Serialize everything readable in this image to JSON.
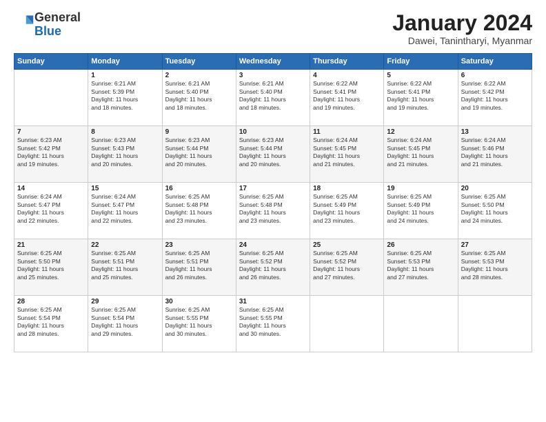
{
  "logo": {
    "general": "General",
    "blue": "Blue"
  },
  "title": "January 2024",
  "subtitle": "Dawei, Tanintharyi, Myanmar",
  "headers": [
    "Sunday",
    "Monday",
    "Tuesday",
    "Wednesday",
    "Thursday",
    "Friday",
    "Saturday"
  ],
  "rows": [
    [
      {
        "day": "",
        "info": ""
      },
      {
        "day": "1",
        "info": "Sunrise: 6:21 AM\nSunset: 5:39 PM\nDaylight: 11 hours\nand 18 minutes."
      },
      {
        "day": "2",
        "info": "Sunrise: 6:21 AM\nSunset: 5:40 PM\nDaylight: 11 hours\nand 18 minutes."
      },
      {
        "day": "3",
        "info": "Sunrise: 6:21 AM\nSunset: 5:40 PM\nDaylight: 11 hours\nand 18 minutes."
      },
      {
        "day": "4",
        "info": "Sunrise: 6:22 AM\nSunset: 5:41 PM\nDaylight: 11 hours\nand 19 minutes."
      },
      {
        "day": "5",
        "info": "Sunrise: 6:22 AM\nSunset: 5:41 PM\nDaylight: 11 hours\nand 19 minutes."
      },
      {
        "day": "6",
        "info": "Sunrise: 6:22 AM\nSunset: 5:42 PM\nDaylight: 11 hours\nand 19 minutes."
      }
    ],
    [
      {
        "day": "7",
        "info": "Sunrise: 6:23 AM\nSunset: 5:42 PM\nDaylight: 11 hours\nand 19 minutes."
      },
      {
        "day": "8",
        "info": "Sunrise: 6:23 AM\nSunset: 5:43 PM\nDaylight: 11 hours\nand 20 minutes."
      },
      {
        "day": "9",
        "info": "Sunrise: 6:23 AM\nSunset: 5:44 PM\nDaylight: 11 hours\nand 20 minutes."
      },
      {
        "day": "10",
        "info": "Sunrise: 6:23 AM\nSunset: 5:44 PM\nDaylight: 11 hours\nand 20 minutes."
      },
      {
        "day": "11",
        "info": "Sunrise: 6:24 AM\nSunset: 5:45 PM\nDaylight: 11 hours\nand 21 minutes."
      },
      {
        "day": "12",
        "info": "Sunrise: 6:24 AM\nSunset: 5:45 PM\nDaylight: 11 hours\nand 21 minutes."
      },
      {
        "day": "13",
        "info": "Sunrise: 6:24 AM\nSunset: 5:46 PM\nDaylight: 11 hours\nand 21 minutes."
      }
    ],
    [
      {
        "day": "14",
        "info": "Sunrise: 6:24 AM\nSunset: 5:47 PM\nDaylight: 11 hours\nand 22 minutes."
      },
      {
        "day": "15",
        "info": "Sunrise: 6:24 AM\nSunset: 5:47 PM\nDaylight: 11 hours\nand 22 minutes."
      },
      {
        "day": "16",
        "info": "Sunrise: 6:25 AM\nSunset: 5:48 PM\nDaylight: 11 hours\nand 23 minutes."
      },
      {
        "day": "17",
        "info": "Sunrise: 6:25 AM\nSunset: 5:48 PM\nDaylight: 11 hours\nand 23 minutes."
      },
      {
        "day": "18",
        "info": "Sunrise: 6:25 AM\nSunset: 5:49 PM\nDaylight: 11 hours\nand 23 minutes."
      },
      {
        "day": "19",
        "info": "Sunrise: 6:25 AM\nSunset: 5:49 PM\nDaylight: 11 hours\nand 24 minutes."
      },
      {
        "day": "20",
        "info": "Sunrise: 6:25 AM\nSunset: 5:50 PM\nDaylight: 11 hours\nand 24 minutes."
      }
    ],
    [
      {
        "day": "21",
        "info": "Sunrise: 6:25 AM\nSunset: 5:50 PM\nDaylight: 11 hours\nand 25 minutes."
      },
      {
        "day": "22",
        "info": "Sunrise: 6:25 AM\nSunset: 5:51 PM\nDaylight: 11 hours\nand 25 minutes."
      },
      {
        "day": "23",
        "info": "Sunrise: 6:25 AM\nSunset: 5:51 PM\nDaylight: 11 hours\nand 26 minutes."
      },
      {
        "day": "24",
        "info": "Sunrise: 6:25 AM\nSunset: 5:52 PM\nDaylight: 11 hours\nand 26 minutes."
      },
      {
        "day": "25",
        "info": "Sunrise: 6:25 AM\nSunset: 5:52 PM\nDaylight: 11 hours\nand 27 minutes."
      },
      {
        "day": "26",
        "info": "Sunrise: 6:25 AM\nSunset: 5:53 PM\nDaylight: 11 hours\nand 27 minutes."
      },
      {
        "day": "27",
        "info": "Sunrise: 6:25 AM\nSunset: 5:53 PM\nDaylight: 11 hours\nand 28 minutes."
      }
    ],
    [
      {
        "day": "28",
        "info": "Sunrise: 6:25 AM\nSunset: 5:54 PM\nDaylight: 11 hours\nand 28 minutes."
      },
      {
        "day": "29",
        "info": "Sunrise: 6:25 AM\nSunset: 5:54 PM\nDaylight: 11 hours\nand 29 minutes."
      },
      {
        "day": "30",
        "info": "Sunrise: 6:25 AM\nSunset: 5:55 PM\nDaylight: 11 hours\nand 30 minutes."
      },
      {
        "day": "31",
        "info": "Sunrise: 6:25 AM\nSunset: 5:55 PM\nDaylight: 11 hours\nand 30 minutes."
      },
      {
        "day": "",
        "info": ""
      },
      {
        "day": "",
        "info": ""
      },
      {
        "day": "",
        "info": ""
      }
    ]
  ]
}
